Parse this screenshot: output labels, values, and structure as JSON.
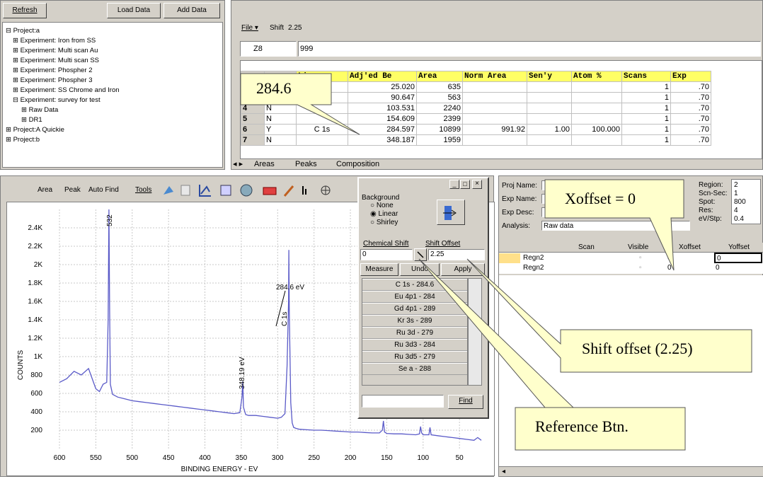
{
  "tree_panel": {
    "buttons": [
      "Refresh",
      "Load Data",
      "Add Data"
    ],
    "items": [
      "⊟ Project:a",
      "⊞ Experiment: Iron from SS",
      "⊞ Experiment: Multi scan Au",
      "⊞ Experiment: Multi scan SS",
      "⊞ Experiment: Phospher 2",
      "⊞ Experiment: Phospher 3",
      "⊞ Experiment: SS Chrome and Iron",
      "⊟ Experiment: survey for test",
      "⊞ Raw Data",
      "⊞ DR1",
      "⊞ Project:A Quickie",
      "⊞ Project:b"
    ]
  },
  "grid_panel": {
    "file_menu": "File ▾",
    "shift_label": "Shift",
    "shift_value": "2.25",
    "cell_ref": "Z8",
    "cell_value": "999",
    "headers": [
      "Line",
      "Adj'ed Be",
      "Area",
      "Norm Area",
      "Sen'y",
      "Atom %",
      "Scans",
      "Exp"
    ],
    "rows": [
      {
        "num": "",
        "flag": "",
        "line": "",
        "be": "25.020",
        "area": "635",
        "norm": "",
        "sen": "",
        "atom": "",
        "scans": "1",
        "exp": ".70"
      },
      {
        "num": "",
        "flag": "",
        "line": "",
        "be": "90.647",
        "area": "563",
        "norm": "",
        "sen": "",
        "atom": "",
        "scans": "1",
        "exp": ".70"
      },
      {
        "num": "4",
        "flag": "N",
        "line": "",
        "be": "103.531",
        "area": "2240",
        "norm": "",
        "sen": "",
        "atom": "",
        "scans": "1",
        "exp": ".70"
      },
      {
        "num": "5",
        "flag": "N",
        "line": "",
        "be": "154.609",
        "area": "2399",
        "norm": "",
        "sen": "",
        "atom": "",
        "scans": "1",
        "exp": ".70"
      },
      {
        "num": "6",
        "flag": "Y",
        "line": "C 1s",
        "be": "284.597",
        "area": "10899",
        "norm": "991.92",
        "sen": "1.00",
        "atom": "100.000",
        "scans": "1",
        "exp": ".70"
      },
      {
        "num": "7",
        "flag": "N",
        "line": "",
        "be": "348.187",
        "area": "1959",
        "norm": "",
        "sen": "",
        "atom": "",
        "scans": "1",
        "exp": ".70"
      }
    ],
    "tabs": [
      "Areas",
      "Peaks",
      "Composition"
    ]
  },
  "plot_toolbar": {
    "buttons": [
      "Area",
      "Peak",
      "Auto Find",
      "Tools"
    ]
  },
  "chart_data": {
    "type": "line",
    "xlabel": "BINDING ENERGY - EV",
    "ylabel": "COUNTS",
    "xlim": [
      600,
      20
    ],
    "ylim": [
      0,
      2600
    ],
    "x_ticks": [
      600,
      550,
      500,
      450,
      400,
      350,
      300,
      250,
      200,
      150,
      100,
      50
    ],
    "y_ticks": [
      200,
      400,
      600,
      800,
      1000,
      1200,
      1400,
      1600,
      1800,
      2000,
      2200,
      2400
    ],
    "y_tick_labels": [
      "200",
      "400",
      "600",
      "800",
      "1K",
      "1.2K",
      "1.4K",
      "1.6K",
      "1.8K",
      "2K",
      "2.2K",
      "2.4K"
    ],
    "series_color": "#5a5ac8",
    "x": [
      600,
      590,
      580,
      570,
      560,
      550,
      545,
      540,
      535,
      533,
      532,
      531,
      530,
      527,
      520,
      510,
      500,
      490,
      480,
      470,
      460,
      450,
      440,
      430,
      420,
      410,
      400,
      390,
      380,
      370,
      360,
      352,
      349,
      348,
      347,
      344,
      340,
      330,
      320,
      310,
      300,
      295,
      290,
      287,
      285,
      284.6,
      284,
      282,
      280,
      278,
      275,
      270,
      260,
      250,
      240,
      230,
      220,
      210,
      200,
      190,
      180,
      170,
      160,
      156,
      154.6,
      153,
      150,
      140,
      130,
      120,
      110,
      105,
      103.5,
      102,
      100,
      92,
      90.6,
      89,
      80,
      70,
      60,
      50,
      40,
      30,
      25,
      20
    ],
    "y": [
      720,
      760,
      840,
      800,
      870,
      650,
      620,
      700,
      720,
      1400,
      2700,
      1500,
      700,
      590,
      560,
      540,
      520,
      510,
      500,
      490,
      480,
      470,
      460,
      450,
      440,
      430,
      420,
      410,
      400,
      390,
      380,
      390,
      560,
      730,
      450,
      370,
      360,
      360,
      350,
      340,
      330,
      340,
      380,
      900,
      1600,
      2160,
      1500,
      500,
      280,
      230,
      220,
      210,
      205,
      200,
      200,
      195,
      190,
      185,
      180,
      180,
      175,
      170,
      170,
      200,
      300,
      180,
      165,
      160,
      160,
      155,
      150,
      160,
      240,
      170,
      150,
      150,
      230,
      150,
      140,
      130,
      120,
      110,
      100,
      90,
      120,
      90
    ],
    "annotations": [
      "532",
      "284.6 eV",
      "C 1s",
      "348.19 eV"
    ]
  },
  "reference_dialog": {
    "background_label": "Background",
    "radio_options": [
      "None",
      "Linear",
      "Shirley"
    ],
    "selected_option": "Linear",
    "chem_shift_label": "Chemical Shift",
    "shift_offset_label": "Shift Offset",
    "chem_shift_value": "0",
    "shift_offset_value": "2.25",
    "buttons": [
      "Measure",
      "Undo",
      "Apply"
    ],
    "refs": [
      "C 1s - 284.6",
      "Eu 4p1 - 284",
      "Gd 4p1 - 289",
      "Kr 3s - 289",
      "Ru 3d - 279",
      "Ru 3d3 - 284",
      "Ru 3d5 - 279",
      "Se a - 288"
    ],
    "find_label": "Find"
  },
  "info_panel": {
    "labels": [
      "Proj Name:",
      "Exp Name:",
      "Exp Desc:",
      "Analysis:"
    ],
    "analysis_value": "Raw data",
    "right_labels": [
      "Region:",
      "Scn-Sec:",
      "Spot:",
      "Res:",
      "eV/Stp:"
    ],
    "right_values": [
      "2",
      "1",
      "800",
      "4",
      "0.4"
    ],
    "scan_headers": [
      "Scan",
      "Visible",
      "Xoffset",
      "Yoffset"
    ],
    "scan_rows": [
      {
        "name": "Regn2",
        "xoffset": "0",
        "yoffset": "0"
      },
      {
        "name": "Regn2",
        "xoffset": "0",
        "yoffset": "0"
      }
    ]
  },
  "callouts": {
    "be_value": "284.6",
    "xoffset": "Xoffset = 0",
    "shift_offset": "Shift offset (2.25)",
    "reference_btn": "Reference Btn."
  }
}
